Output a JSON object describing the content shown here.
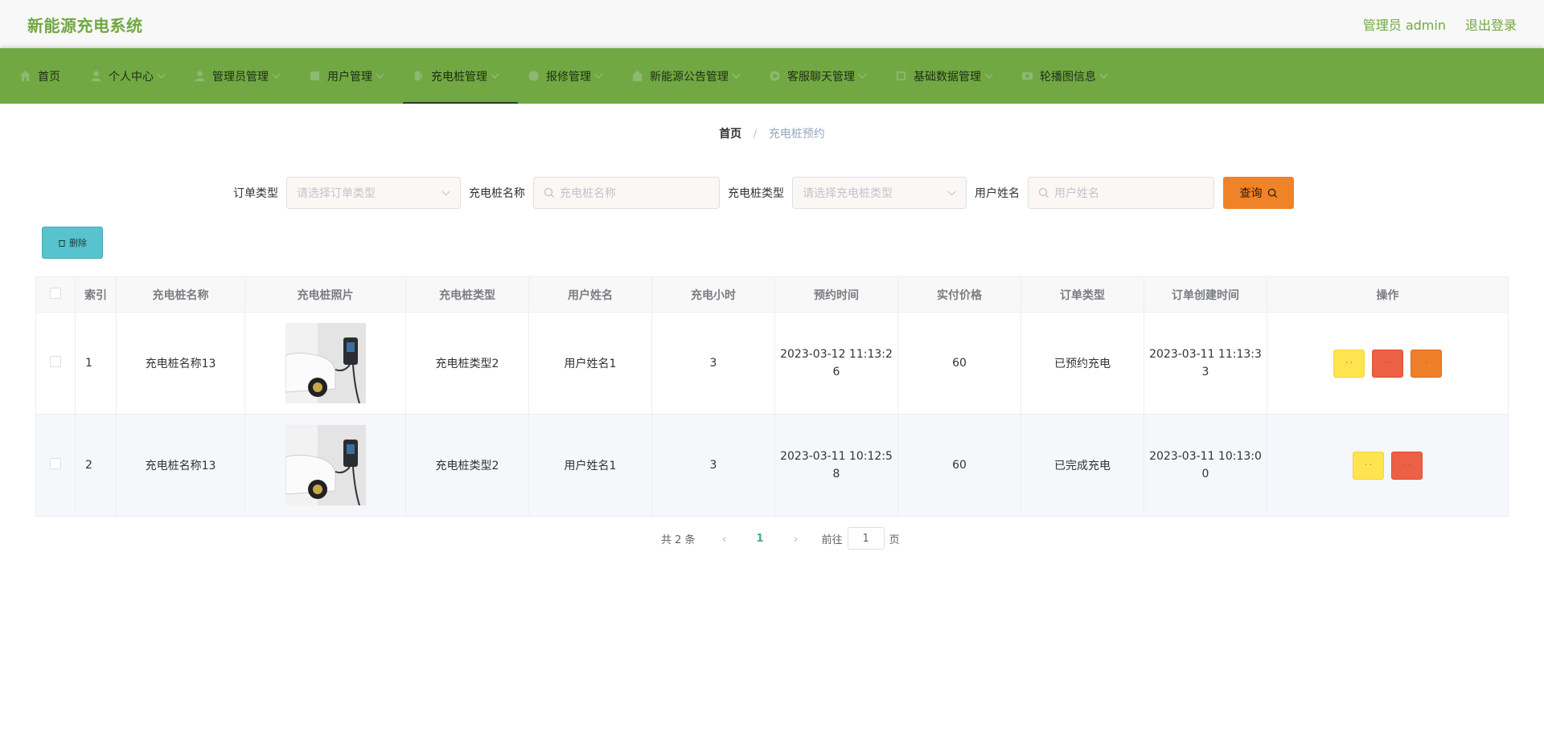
{
  "header": {
    "brand": "新能源充电系统",
    "admin_label": "管理员 admin",
    "logout_label": "退出登录"
  },
  "nav": {
    "items": [
      {
        "label": "首页",
        "icon": "home-icon",
        "has_caret": false
      },
      {
        "label": "个人中心",
        "icon": "user-icon",
        "has_caret": true
      },
      {
        "label": "管理员管理",
        "icon": "admin-icon",
        "has_caret": true
      },
      {
        "label": "用户管理",
        "icon": "users-icon",
        "has_caret": true
      },
      {
        "label": "充电桩管理",
        "icon": "charger-icon",
        "has_caret": true,
        "active": true
      },
      {
        "label": "报修管理",
        "icon": "repair-icon",
        "has_caret": true
      },
      {
        "label": "新能源公告管理",
        "icon": "notice-icon",
        "has_caret": true
      },
      {
        "label": "客服聊天管理",
        "icon": "chat-icon",
        "has_caret": true
      },
      {
        "label": "基础数据管理",
        "icon": "data-icon",
        "has_caret": true
      },
      {
        "label": "轮播图信息",
        "icon": "carousel-icon",
        "has_caret": true
      }
    ]
  },
  "breadcrumb": {
    "home": "首页",
    "separator": "/",
    "current": "充电桩预约"
  },
  "search": {
    "order_type_label": "订单类型",
    "order_type_placeholder": "请选择订单类型",
    "name_label": "充电桩名称",
    "name_placeholder": "充电桩名称",
    "type_label": "充电桩类型",
    "type_placeholder": "请选择充电桩类型",
    "user_label": "用户姓名",
    "user_placeholder": "用户姓名",
    "query_label": "查询"
  },
  "toolbar": {
    "delete_label": "删除"
  },
  "table": {
    "columns": [
      "索引",
      "充电桩名称",
      "充电桩照片",
      "充电桩类型",
      "用户姓名",
      "充电小时",
      "预约时间",
      "实付价格",
      "订单类型",
      "订单创建时间",
      "操作"
    ],
    "rows": [
      {
        "index": "1",
        "name": "充电桩名称13",
        "type": "充电桩类型2",
        "user": "用户姓名1",
        "hours": "3",
        "reserve_time_a": "2023-03-12 11:13:2",
        "reserve_time_b": "6",
        "price": "60",
        "order_type": "已预约充电",
        "created_a": "2023-03-11 11:13:3",
        "created_b": "3"
      },
      {
        "index": "2",
        "name": "充电桩名称13",
        "type": "充电桩类型2",
        "user": "用户姓名1",
        "hours": "3",
        "reserve_time_a": "2023-03-11 10:12:5",
        "reserve_time_b": "8",
        "price": "60",
        "order_type": "已完成充电",
        "created_a": "2023-03-11 10:13:0",
        "created_b": "0"
      }
    ]
  },
  "pagination": {
    "total": "共 2 条",
    "current_page": "1",
    "goto_label": "前往",
    "jump_value": "1",
    "page_suffix": "页"
  },
  "colors": {
    "brand": "#71a843",
    "nav_bg": "#71a843",
    "query_btn": "#f08227",
    "delete_btn": "#56c3cf",
    "op_yellow": "#ffe34f",
    "op_red": "#ec6045",
    "op_orange": "#f07f2a"
  }
}
